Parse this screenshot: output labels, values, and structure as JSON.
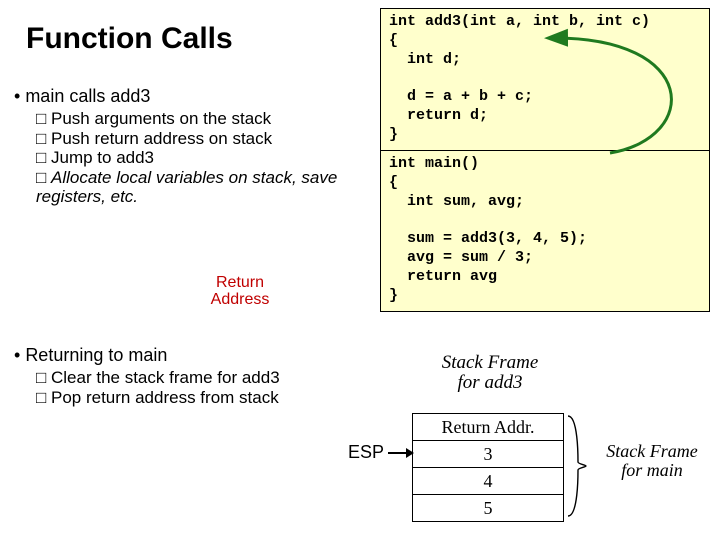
{
  "title": "Function Calls",
  "section1": {
    "heading": "main calls add3",
    "items": [
      "Push arguments on the stack",
      "Push return address on stack",
      "Jump to add3",
      "Allocate local variables on stack, save registers, etc."
    ]
  },
  "return_address_label": "Return\nAddress",
  "section2": {
    "heading": "Returning to main",
    "items": [
      "Clear the stack frame for add3",
      "Pop return address from stack"
    ]
  },
  "code": {
    "add3": "int add3(int a, int b, int c)\n{\n  int d;\n\n  d = a + b + c;\n  return d;\n}",
    "main": "int main()\n{\n  int sum, avg;\n\n  sum = add3(3, 4, 5);\n  avg = sum / 3;\n  return avg\n}"
  },
  "stack": {
    "frame_add3_label": "Stack Frame\nfor add3",
    "cells": [
      "Return Addr.",
      "3",
      "4",
      "5"
    ],
    "esp_label": "ESP",
    "frame_main_label": "Stack Frame\nfor main"
  }
}
